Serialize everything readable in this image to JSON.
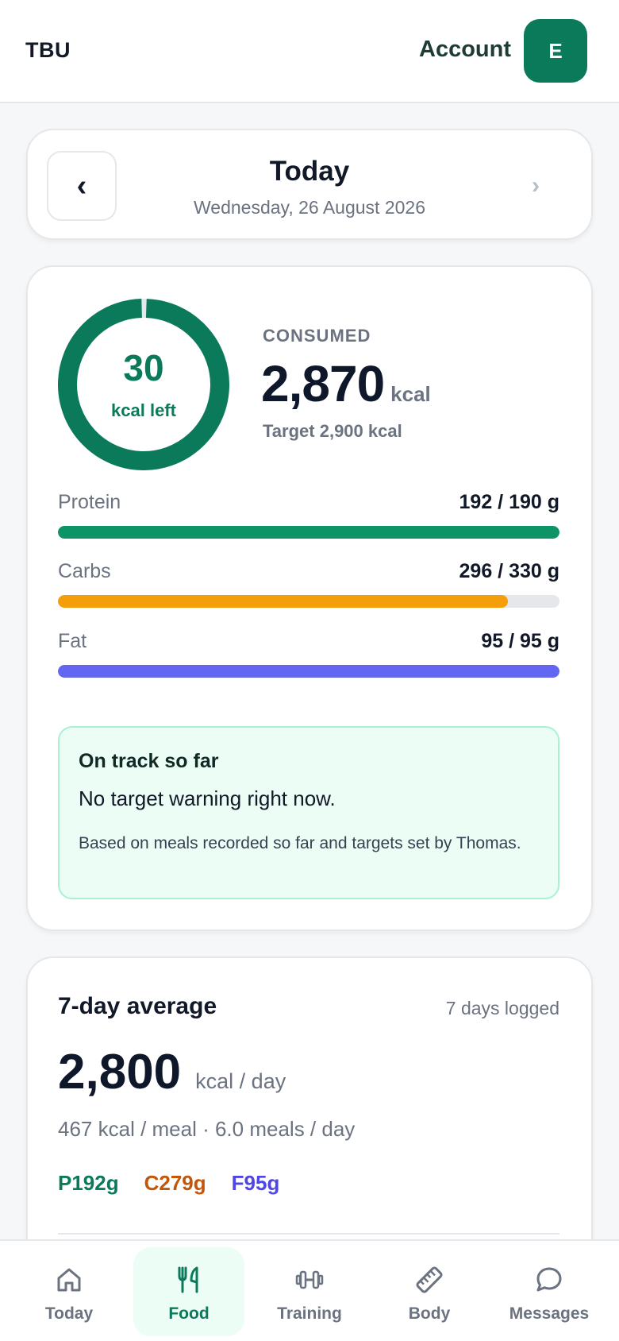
{
  "header": {
    "brand": "TBU",
    "account_label": "Account",
    "avatar_initial": "E"
  },
  "date_nav": {
    "title": "Today",
    "subtitle": "Wednesday, 26 August 2026",
    "prev_icon": "‹",
    "next_icon": "›"
  },
  "summary": {
    "ring_value": "30",
    "ring_label": "kcal left",
    "ring_progress": 0.99,
    "consumed_label": "CONSUMED",
    "consumed_value": "2,870",
    "consumed_unit": "kcal",
    "target_text": "Target 2,900 kcal"
  },
  "macros": [
    {
      "name": "Protein",
      "value": "192 / 190 g",
      "progress": 1.0,
      "color": "#0d9466"
    },
    {
      "name": "Carbs",
      "value": "296 / 330 g",
      "progress": 0.897,
      "color": "#f59e0b"
    },
    {
      "name": "Fat",
      "value": "95 / 95 g",
      "progress": 1.0,
      "color": "#6366f1"
    }
  ],
  "notice": {
    "title": "On track so far",
    "body": "No target warning right now.",
    "note": "Based on meals recorded so far and targets set by Thomas."
  },
  "weekly": {
    "title": "7-day average",
    "logged": "7 days logged",
    "value": "2,800",
    "unit": "kcal / day",
    "meta": "467 kcal / meal · 6.0 meals / day",
    "macros": [
      {
        "label": "P192g",
        "color": "#0b7a5a"
      },
      {
        "label": "C279g",
        "color": "#c2570c"
      },
      {
        "label": "F95g",
        "color": "#4f46e5"
      }
    ]
  },
  "nav": [
    {
      "label": "Today",
      "icon": "home-icon",
      "active": false
    },
    {
      "label": "Food",
      "icon": "fork-knife-icon",
      "active": true
    },
    {
      "label": "Training",
      "icon": "dumbbell-icon",
      "active": false
    },
    {
      "label": "Body",
      "icon": "ruler-icon",
      "active": false
    },
    {
      "label": "Messages",
      "icon": "chat-bubble-icon",
      "active": false
    }
  ],
  "colors": {
    "brand_green": "#0b7a5a",
    "ring_track": "#e5e7eb"
  }
}
